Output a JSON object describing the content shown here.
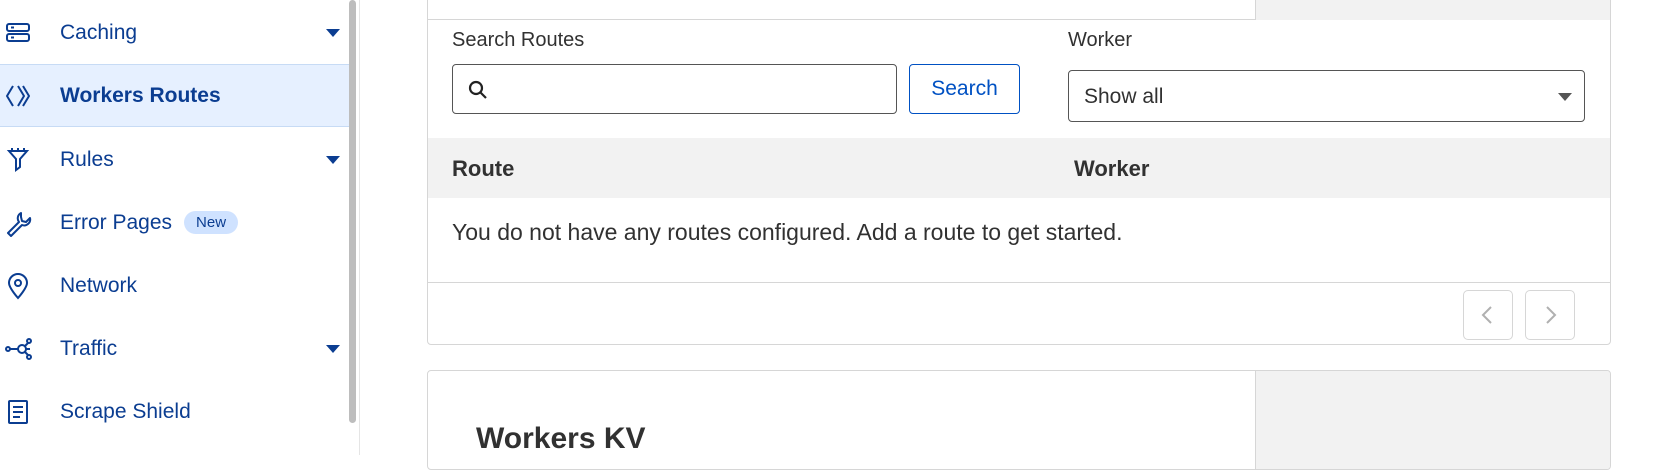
{
  "sidebar": {
    "items": [
      {
        "label": "Caching",
        "icon": "caching-icon",
        "has_caret": true
      },
      {
        "label": "Workers Routes",
        "icon": "workers-routes-icon",
        "active": true
      },
      {
        "label": "Rules",
        "icon": "rules-icon",
        "has_caret": true
      },
      {
        "label": "Error Pages",
        "icon": "wrench-icon",
        "badge": "New"
      },
      {
        "label": "Network",
        "icon": "location-pin-icon"
      },
      {
        "label": "Traffic",
        "icon": "traffic-icon",
        "has_caret": true
      },
      {
        "label": "Scrape Shield",
        "icon": "document-icon"
      }
    ]
  },
  "routes": {
    "search_label": "Search Routes",
    "search_placeholder": "",
    "search_button": "Search",
    "worker_label": "Worker",
    "worker_selected": "Show all",
    "columns": [
      "Route",
      "Worker"
    ],
    "empty_message": "You do not have any routes configured. Add a route to get started."
  },
  "kv": {
    "title": "Workers KV"
  },
  "colors": {
    "accent": "#0051c3",
    "nav_text": "#0b3d91",
    "active_bg": "#e6f0ff"
  }
}
